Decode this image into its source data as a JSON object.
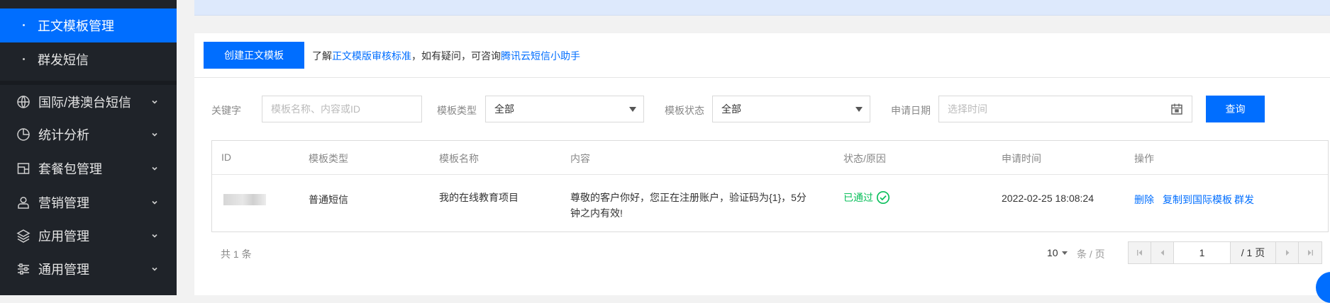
{
  "sidebar": {
    "sub_items": [
      {
        "label": "正文模板管理",
        "active": true
      },
      {
        "label": "群发短信",
        "active": false
      }
    ],
    "items": [
      {
        "label": "国际/港澳台短信",
        "icon": "globe-icon"
      },
      {
        "label": "统计分析",
        "icon": "pie-chart-icon"
      },
      {
        "label": "套餐包管理",
        "icon": "package-icon"
      },
      {
        "label": "营销管理",
        "icon": "user-icon"
      },
      {
        "label": "应用管理",
        "icon": "layers-icon"
      },
      {
        "label": "通用管理",
        "icon": "sliders-icon"
      }
    ]
  },
  "toolbar": {
    "create_label": "创建正文模板",
    "notice_prefix": "了解",
    "notice_link1": "正文模版审核标准",
    "notice_middle": "，如有疑问，可咨询",
    "notice_link2": "腾讯云短信小助手"
  },
  "filters": {
    "keyword_label": "关键字",
    "keyword_placeholder": "模板名称、内容或ID",
    "type_label": "模板类型",
    "type_value": "全部",
    "status_label": "模板状态",
    "status_value": "全部",
    "date_label": "申请日期",
    "date_placeholder": "选择时间",
    "query_label": "查询"
  },
  "table": {
    "headers": [
      "ID",
      "模板类型",
      "模板名称",
      "内容",
      "状态/原因",
      "申请时间",
      "操作"
    ],
    "rows": [
      {
        "id": "",
        "type": "普通短信",
        "name": "我的在线教育项目",
        "content_line1": "尊敬的客户你好，您正在注册账户，验证码为{1}，5分",
        "content_line2": "钟之内有效!",
        "status": "已通过",
        "time": "2022-02-25 18:08:24",
        "actions": [
          "删除",
          "复制到国际模板",
          "群发"
        ]
      }
    ]
  },
  "pagination": {
    "total_text": "共 1 条",
    "page_size": "10",
    "page_size_unit": "条 / 页",
    "current_page": "1",
    "total_pages": "/ 1 页"
  },
  "colors": {
    "sidebar_bg": "#1f2329",
    "accent": "#006eff",
    "success": "#0abf5b"
  }
}
